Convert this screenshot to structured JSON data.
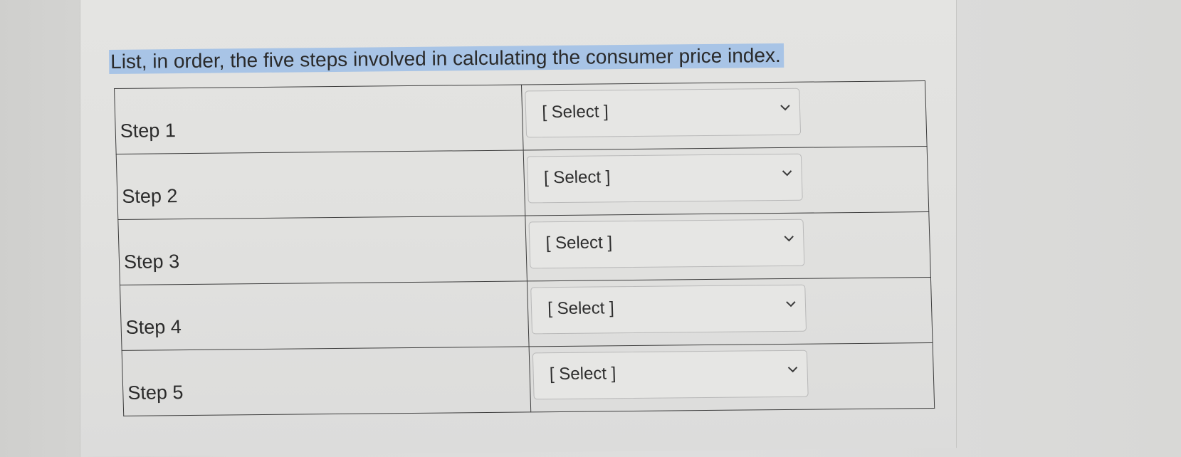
{
  "question": {
    "text": "List, in order, the five steps involved in calculating the consumer price index."
  },
  "steps": [
    {
      "label": "Step 1",
      "select_value": "[ Select ]"
    },
    {
      "label": "Step 2",
      "select_value": "[ Select ]"
    },
    {
      "label": "Step 3",
      "select_value": "[ Select ]"
    },
    {
      "label": "Step 4",
      "select_value": "[ Select ]"
    },
    {
      "label": "Step 5",
      "select_value": "[ Select ]"
    }
  ],
  "icons": {
    "dropdown": "chevron-down-icon"
  },
  "colors": {
    "highlight": "#a8c4e6",
    "table_border": "#3d3d3d",
    "select_border": "#b9b9b9"
  }
}
